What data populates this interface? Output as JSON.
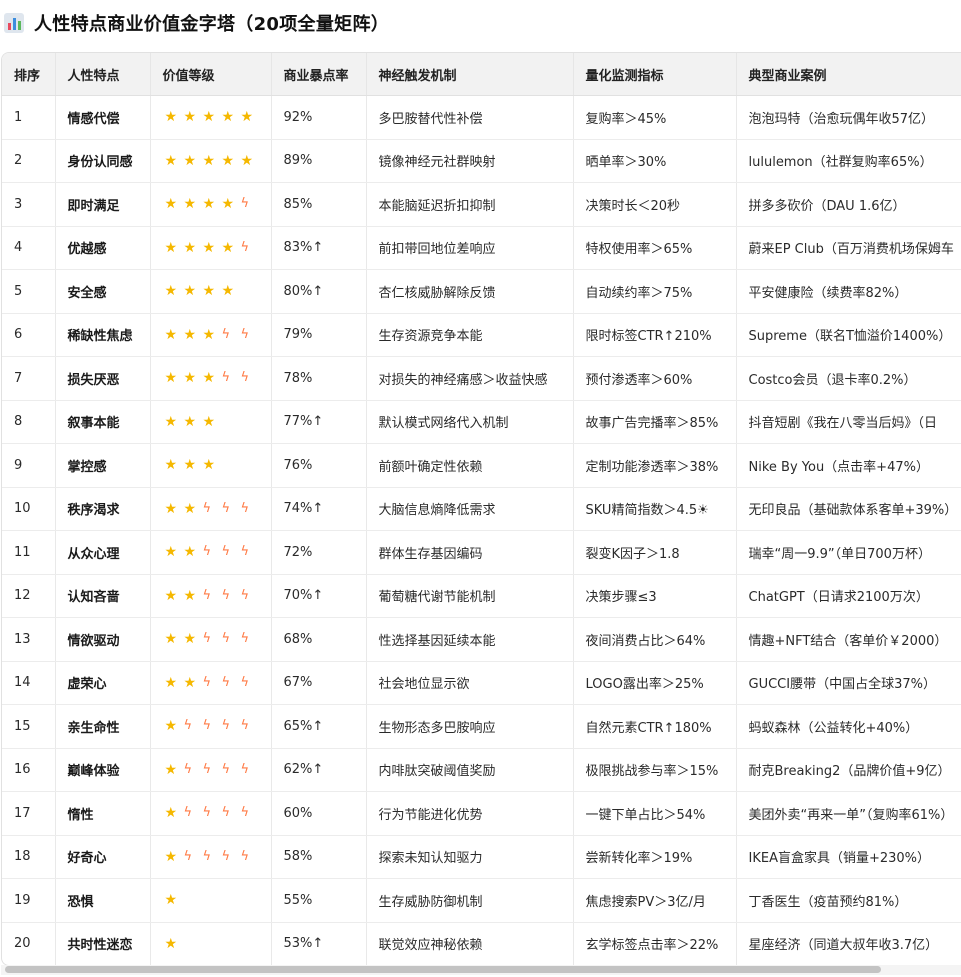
{
  "page": {
    "title": "人性特点商业价值金字塔（20项全量矩阵）",
    "title_icon": "bar-chart-icon"
  },
  "table": {
    "headers": [
      "排序",
      "人性特点",
      "价值等级",
      "商业暴点率",
      "神经触发机制",
      "量化监测指标",
      "典型商业案例"
    ],
    "rows": [
      {
        "rank": "1",
        "trait": "情感代偿",
        "stars": 5,
        "bolts": 0,
        "rate": "92%",
        "mechanism": "多巴胺替代性补偿",
        "metric": "复购率＞45%",
        "case": "泡泡玛特（治愈玩偶年收57亿）"
      },
      {
        "rank": "2",
        "trait": "身份认同感",
        "stars": 5,
        "bolts": 0,
        "rate": "89%",
        "mechanism": "镜像神经元社群映射",
        "metric": "晒单率＞30%",
        "case": "lululemon（社群复购率65%）"
      },
      {
        "rank": "3",
        "trait": "即时满足",
        "stars": 4,
        "bolts": 1,
        "rate": "85%",
        "mechanism": "本能脑延迟折扣抑制",
        "metric": "决策时长＜20秒",
        "case": "拼多多砍价（DAU 1.6亿）"
      },
      {
        "rank": "4",
        "trait": "优越感",
        "stars": 4,
        "bolts": 1,
        "rate": "83%↑",
        "mechanism": "前扣带回地位差响应",
        "metric": "特权使用率＞65%",
        "case": "蔚来EP Club（百万消费机场保姆车"
      },
      {
        "rank": "5",
        "trait": "安全感",
        "stars": 4,
        "bolts": 0,
        "rate": "80%↑",
        "mechanism": "杏仁核威胁解除反馈",
        "metric": "自动续约率＞75%",
        "case": "平安健康险（续费率82%）"
      },
      {
        "rank": "6",
        "trait": "稀缺性焦虑",
        "stars": 3,
        "bolts": 2,
        "rate": "79%",
        "mechanism": "生存资源竞争本能",
        "metric": "限时标签CTR↑210%",
        "case": "Supreme（联名T恤溢价1400%）"
      },
      {
        "rank": "7",
        "trait": "损失厌恶",
        "stars": 3,
        "bolts": 2,
        "rate": "78%",
        "mechanism": "对损失的神经痛感＞收益快感",
        "metric": "预付渗透率＞60%",
        "case": "Costco会员（退卡率0.2%）"
      },
      {
        "rank": "8",
        "trait": "叙事本能",
        "stars": 3,
        "bolts": 0,
        "rate": "77%↑",
        "mechanism": "默认模式网络代入机制",
        "metric": "故事广告完播率＞85%",
        "case": "抖音短剧《我在八零当后妈》（日"
      },
      {
        "rank": "9",
        "trait": "掌控感",
        "stars": 3,
        "bolts": 0,
        "rate": "76%",
        "mechanism": "前额叶确定性依赖",
        "metric": "定制功能渗透率＞38%",
        "case": "Nike By You（点击率+47%）"
      },
      {
        "rank": "10",
        "trait": "秩序渴求",
        "stars": 2,
        "bolts": 3,
        "rate": "74%↑",
        "mechanism": "大脑信息熵降低需求",
        "metric": "SKU精简指数＞4.5☀",
        "case": "无印良品（基础款体系客单+39%）"
      },
      {
        "rank": "11",
        "trait": "从众心理",
        "stars": 2,
        "bolts": 3,
        "rate": "72%",
        "mechanism": "群体生存基因编码",
        "metric": "裂变K因子＞1.8",
        "case": "瑞幸“周一9.9”（单日700万杯）"
      },
      {
        "rank": "12",
        "trait": "认知吝啬",
        "stars": 2,
        "bolts": 3,
        "rate": "70%↑",
        "mechanism": "葡萄糖代谢节能机制",
        "metric": "决策步骤≤3",
        "case": "ChatGPT（日请求2100万次）"
      },
      {
        "rank": "13",
        "trait": "情欲驱动",
        "stars": 2,
        "bolts": 3,
        "rate": "68%",
        "mechanism": "性选择基因延续本能",
        "metric": "夜间消费占比＞64%",
        "case": "情趣+NFT结合（客单价￥2000）"
      },
      {
        "rank": "14",
        "trait": "虚荣心",
        "stars": 2,
        "bolts": 3,
        "rate": "67%",
        "mechanism": "社会地位显示欲",
        "metric": "LOGO露出率＞25%",
        "case": "GUCCI腰带（中国占全球37%）"
      },
      {
        "rank": "15",
        "trait": "亲生命性",
        "stars": 1,
        "bolts": 4,
        "rate": "65%↑",
        "mechanism": "生物形态多巴胺响应",
        "metric": "自然元素CTR↑180%",
        "case": "蚂蚁森林（公益转化+40%）"
      },
      {
        "rank": "16",
        "trait": "巅峰体验",
        "stars": 1,
        "bolts": 4,
        "rate": "62%↑",
        "mechanism": "内啡肽突破阈值奖励",
        "metric": "极限挑战参与率＞15%",
        "case": "耐克Breaking2（品牌价值+9亿）"
      },
      {
        "rank": "17",
        "trait": "惰性",
        "stars": 1,
        "bolts": 4,
        "rate": "60%",
        "mechanism": "行为节能进化优势",
        "metric": "一键下单占比＞54%",
        "case": "美团外卖“再来一单”（复购率61%）"
      },
      {
        "rank": "18",
        "trait": "好奇心",
        "stars": 1,
        "bolts": 4,
        "rate": "58%",
        "mechanism": "探索未知认知驱力",
        "metric": "尝新转化率＞19%",
        "case": "IKEA盲盒家具（销量+230%）"
      },
      {
        "rank": "19",
        "trait": "恐惧",
        "stars": 1,
        "bolts": 0,
        "rate": "55%",
        "mechanism": "生存威胁防御机制",
        "metric": "焦虑搜索PV＞3亿/月",
        "case": "丁香医生（疫苗预约81%）"
      },
      {
        "rank": "20",
        "trait": "共时性迷恋",
        "stars": 1,
        "bolts": 0,
        "rate": "53%↑",
        "mechanism": "联觉效应神秘依赖",
        "metric": "玄学标签点击率＞22%",
        "case": "星座经济（同道大叔年收3.7亿）"
      }
    ]
  },
  "glyphs": {
    "star": "★",
    "bolt": "ϟ"
  },
  "colors": {
    "star": "#f5b800",
    "bolt": "#ff7a45",
    "header_bg": "#f2f2f2"
  }
}
